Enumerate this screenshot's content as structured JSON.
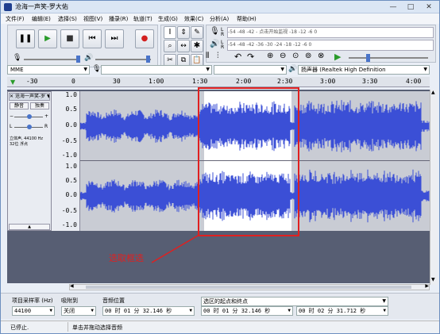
{
  "window": {
    "title": "沧海一声笑-罗大佑",
    "controls": {
      "minimize": "—",
      "maximize": "□",
      "close": "✕"
    }
  },
  "menu": [
    "文件(F)",
    "编辑(E)",
    "选择(S)",
    "视图(V)",
    "播录(R)",
    "轨道(T)",
    "生成(G)",
    "效果(C)",
    "分析(A)",
    "帮助(H)"
  ],
  "transport": {
    "pause": "❚❚",
    "play": "▶",
    "stop": "■",
    "skip_start": "⏮",
    "skip_end": "⏭",
    "record": "●"
  },
  "meters": {
    "record_scale": "-54   -48   -42   -   点击开始监视   -18   -12   -6   0",
    "play_scale": "-54   -48   -42   -36   -30   -24   -18   -12   -6   0"
  },
  "devices": {
    "host": "MME",
    "output": "扬声器 (Realtek High Definition"
  },
  "timeline": {
    "ticks": [
      "-30",
      "0",
      "30",
      "1:00",
      "1:30",
      "2:00",
      "2:30",
      "3:00",
      "3:30",
      "4:00"
    ]
  },
  "track": {
    "name": "沧海一声笑-罗",
    "mute": "静音",
    "solo": "独奏",
    "info_line1": "立体声, 44100 Hz",
    "info_line2": "32位 浮点",
    "collapse": "▲",
    "scale_top": [
      "1.0",
      "0.5",
      "0.0",
      "-0.5",
      "-1.0"
    ],
    "scale_bottom": [
      "1.0",
      "0.5",
      "0.0",
      "-0.5",
      "-1.0"
    ],
    "colors": {
      "wave": "#3b4fd6",
      "wave_dark": "#2233aa",
      "background": "#c9ccd4",
      "selection": "#ffffff"
    }
  },
  "annotation": {
    "text": "选取框选",
    "color": "#e02020"
  },
  "selection_toolbar": {
    "rate_label": "项目采样率 (Hz)",
    "rate_value": "44100",
    "snap_label": "吸附到",
    "snap_value": "关闭",
    "position_label": "音频位置",
    "position_value": "00 时 01 分 32.146 秒",
    "range_label": "选区的起点和终点",
    "start_value": "00 时 01 分 32.146 秒",
    "end_value": "00 时 02 分 31.712 秒"
  },
  "status": {
    "left": "已停止.",
    "right": "单击并拖动选择音频"
  }
}
